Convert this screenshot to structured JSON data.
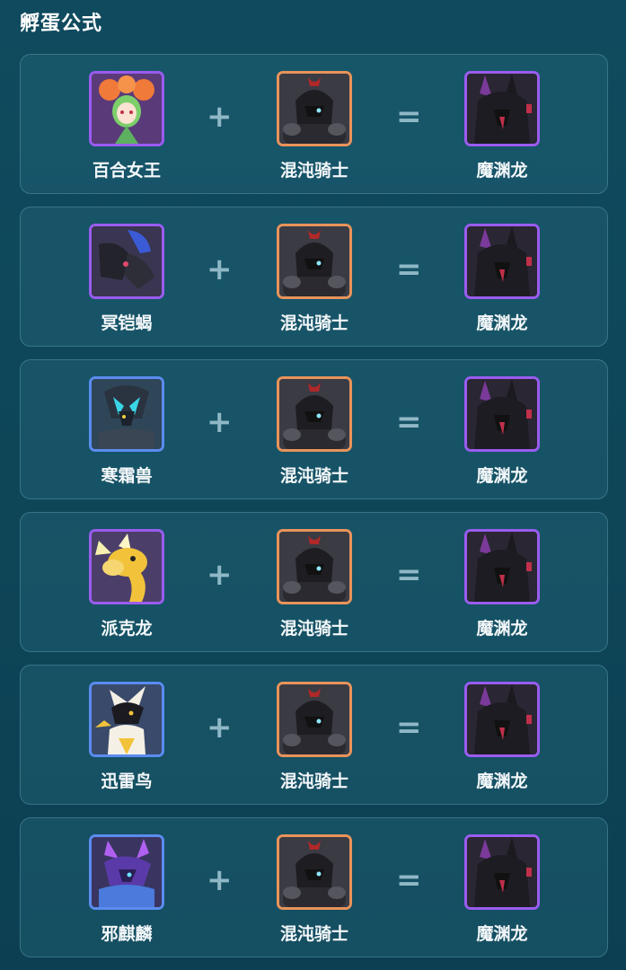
{
  "title": "孵蛋公式",
  "rows": [
    {
      "parent_a": "百合女王",
      "a_frame": "#9a5cf0",
      "a_icon": "lily-queen-portrait-icon",
      "parent_b": "混沌骑士",
      "b_frame": "#e8935a",
      "b_icon": "chaos-knight-portrait-icon",
      "result": "魔渊龙",
      "r_frame": "#9a5cf0",
      "r_icon": "abyss-dragon-portrait-icon",
      "plus": "+",
      "equals": "="
    },
    {
      "parent_a": "冥铠蝎",
      "a_frame": "#9a5cf0",
      "a_icon": "nether-armor-scorpion-portrait-icon",
      "parent_b": "混沌骑士",
      "b_frame": "#e8935a",
      "b_icon": "chaos-knight-portrait-icon",
      "result": "魔渊龙",
      "r_frame": "#9a5cf0",
      "r_icon": "abyss-dragon-portrait-icon",
      "plus": "+",
      "equals": "="
    },
    {
      "parent_a": "寒霜兽",
      "a_frame": "#5a8cf0",
      "a_icon": "frost-beast-portrait-icon",
      "parent_b": "混沌骑士",
      "b_frame": "#e8935a",
      "b_icon": "chaos-knight-portrait-icon",
      "result": "魔渊龙",
      "r_frame": "#9a5cf0",
      "r_icon": "abyss-dragon-portrait-icon",
      "plus": "+",
      "equals": "="
    },
    {
      "parent_a": "派克龙",
      "a_frame": "#9a5cf0",
      "a_icon": "pike-dragon-portrait-icon",
      "parent_b": "混沌骑士",
      "b_frame": "#e8935a",
      "b_icon": "chaos-knight-portrait-icon",
      "result": "魔渊龙",
      "r_frame": "#9a5cf0",
      "r_icon": "abyss-dragon-portrait-icon",
      "plus": "+",
      "equals": "="
    },
    {
      "parent_a": "迅雷鸟",
      "a_frame": "#5a8cf0",
      "a_icon": "thunder-bird-portrait-icon",
      "parent_b": "混沌骑士",
      "b_frame": "#e8935a",
      "b_icon": "chaos-knight-portrait-icon",
      "result": "魔渊龙",
      "r_frame": "#9a5cf0",
      "r_icon": "abyss-dragon-portrait-icon",
      "plus": "+",
      "equals": "="
    },
    {
      "parent_a": "邪麒麟",
      "a_frame": "#5a8cf0",
      "a_icon": "evil-qilin-portrait-icon",
      "parent_b": "混沌骑士",
      "b_frame": "#e8935a",
      "b_icon": "chaos-knight-portrait-icon",
      "result": "魔渊龙",
      "r_frame": "#9a5cf0",
      "r_icon": "abyss-dragon-portrait-icon",
      "plus": "+",
      "equals": "="
    }
  ]
}
